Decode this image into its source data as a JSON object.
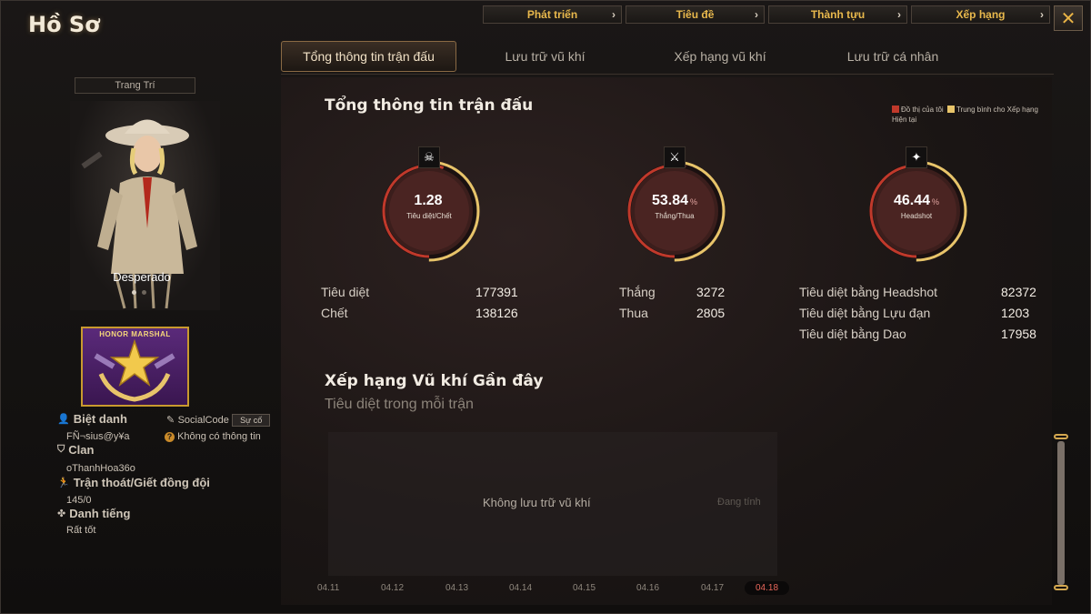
{
  "app": {
    "title": "Hồ Sơ",
    "close_glyph": "✕"
  },
  "top_menu": [
    {
      "label": "Phát triển"
    },
    {
      "label": "Tiêu đề"
    },
    {
      "label": "Thành tựu"
    },
    {
      "label": "Xếp hạng"
    }
  ],
  "tabs": [
    {
      "label": "Tổng thông tin trận đấu",
      "active": true
    },
    {
      "label": "Lưu trữ vũ khí"
    },
    {
      "label": "Xếp hạng vũ khí"
    },
    {
      "label": "Lưu trữ cá nhân"
    }
  ],
  "left": {
    "decoration_label": "Trang Trí",
    "character_name": "Desperado",
    "rank_badge_text": "HONOR MARSHAL",
    "nickname_label": "Biệt danh",
    "nickname_value": "FÑ¬sius@y¥a",
    "socialcode_label": "SocialCode",
    "socialcode_button": "Sự cố",
    "socialcode_value": "Không có thông tin",
    "clan_label": "Clan",
    "clan_value": "oThanhHoa36o",
    "escape_label": "Trận thoát/Giết đồng đội",
    "escape_value": "145/0",
    "reputation_label": "Danh tiếng",
    "reputation_value": "Rất tốt"
  },
  "main": {
    "section_title": "Tổng thông tin trận đấu",
    "legend_mine": "Đồ thị của tôi",
    "legend_avg": "Trung bình cho Xếp hạng Hiện tại",
    "colors": {
      "accent": "#e0a23a",
      "ring_red": "#c0392b",
      "mine": "#c0392b",
      "avg": "#e8c46a"
    },
    "gauges": [
      {
        "value": "1.28",
        "unit": "",
        "label": "Tiêu diệt/Chết",
        "icon": "skull-icon",
        "glyph": "☠",
        "fill": 0.55
      },
      {
        "value": "53.84",
        "unit": "%",
        "label": "Thắng/Thua",
        "icon": "crossed-guns-icon",
        "glyph": "⚔",
        "fill": 0.5384
      },
      {
        "value": "46.44",
        "unit": "%",
        "label": "Headshot",
        "icon": "headshot-icon",
        "glyph": "✦",
        "fill": 0.4644
      }
    ],
    "stats_kd": [
      {
        "label": "Tiêu diệt",
        "value": "177391"
      },
      {
        "label": "Chết",
        "value": "138126"
      }
    ],
    "stats_wl": [
      {
        "label": "Thắng",
        "value": "3272"
      },
      {
        "label": "Thua",
        "value": "2805"
      }
    ],
    "stats_hs": [
      {
        "label": "Tiêu diệt bằng Headshot",
        "value": "82372"
      },
      {
        "label": "Tiêu diệt bằng Lựu đạn",
        "value": "1203"
      },
      {
        "label": "Tiêu diệt bằng Dao",
        "value": "17958"
      }
    ],
    "weapon_rank_title": "Xếp hạng Vũ khí Gần đây",
    "weapon_rank_subtitle": "Tiêu diệt trong mỗi trận",
    "no_weapon": "Không lưu trữ vũ khí",
    "counting": "Đang tính",
    "dates": [
      "04.11",
      "04.12",
      "04.13",
      "04.14",
      "04.15",
      "04.16",
      "04.17",
      "04.18"
    ],
    "active_date": "04.18"
  }
}
